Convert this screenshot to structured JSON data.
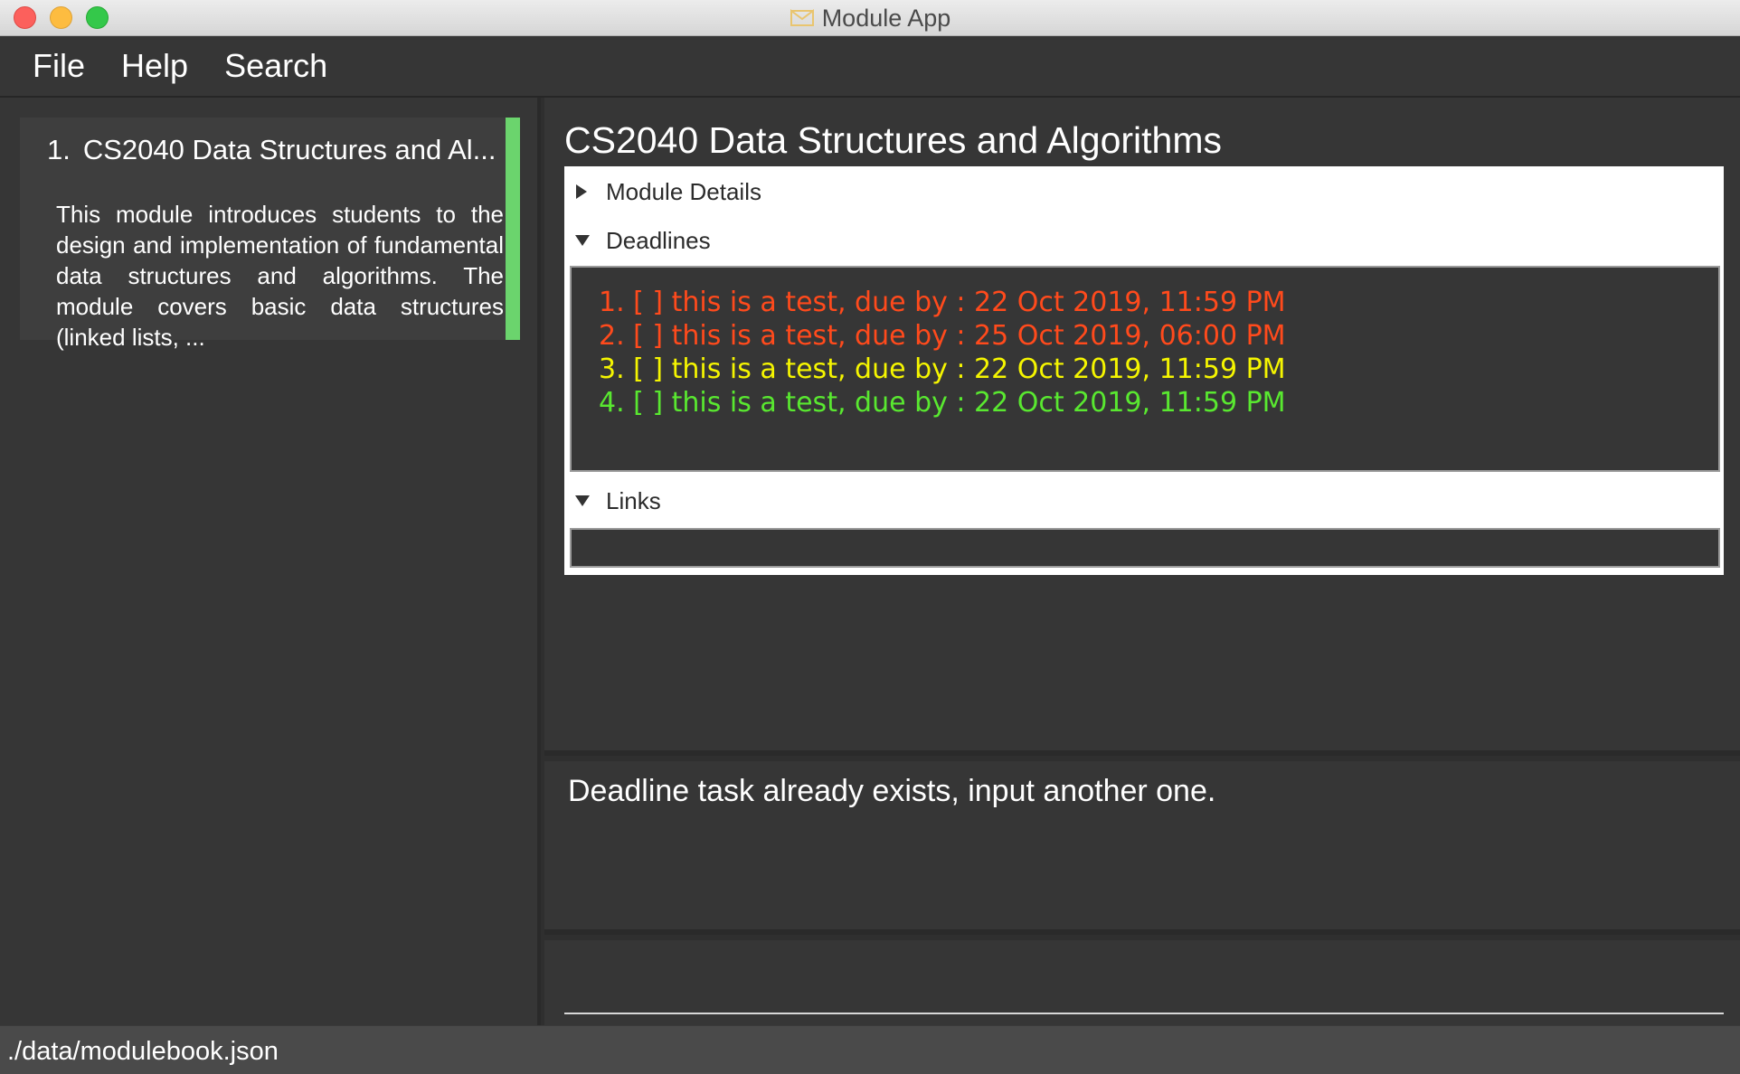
{
  "window": {
    "title": "Module App",
    "app_icon": "envelope-logo-icon"
  },
  "menu": {
    "items": [
      "File",
      "Help",
      "Search"
    ]
  },
  "module_list": {
    "items": [
      {
        "index": "1.",
        "title": "CS2040  Data Structures and Al...",
        "description": "This module introduces students to the design and implementation of fundamental data structures and algorithms. The module covers basic data structures (linked lists, ...",
        "accent_color": "#6bd46d"
      }
    ]
  },
  "module_view": {
    "heading": "CS2040 Data Structures and Algorithms",
    "sections": {
      "details": "Module Details",
      "deadlines": "Deadlines",
      "links": "Links"
    },
    "deadlines": [
      {
        "text": "1. [ ] this is a test, due by : 22 Oct 2019, 11:59 PM",
        "color": "#ff4a1c"
      },
      {
        "text": "2. [ ] this is a test, due by : 25 Oct 2019, 06:00 PM",
        "color": "#ff4a1c"
      },
      {
        "text": "3. [ ] this is a test, due by : 22 Oct 2019, 11:59 PM",
        "color": "#f5f500"
      },
      {
        "text": "4. [ ] this is a test, due by : 22 Oct 2019, 11:59 PM",
        "color": "#59e830"
      }
    ]
  },
  "result": {
    "message": "Deadline task already exists, input another one."
  },
  "command": {
    "value": ""
  },
  "status": {
    "file_path": "./data/modulebook.json"
  }
}
